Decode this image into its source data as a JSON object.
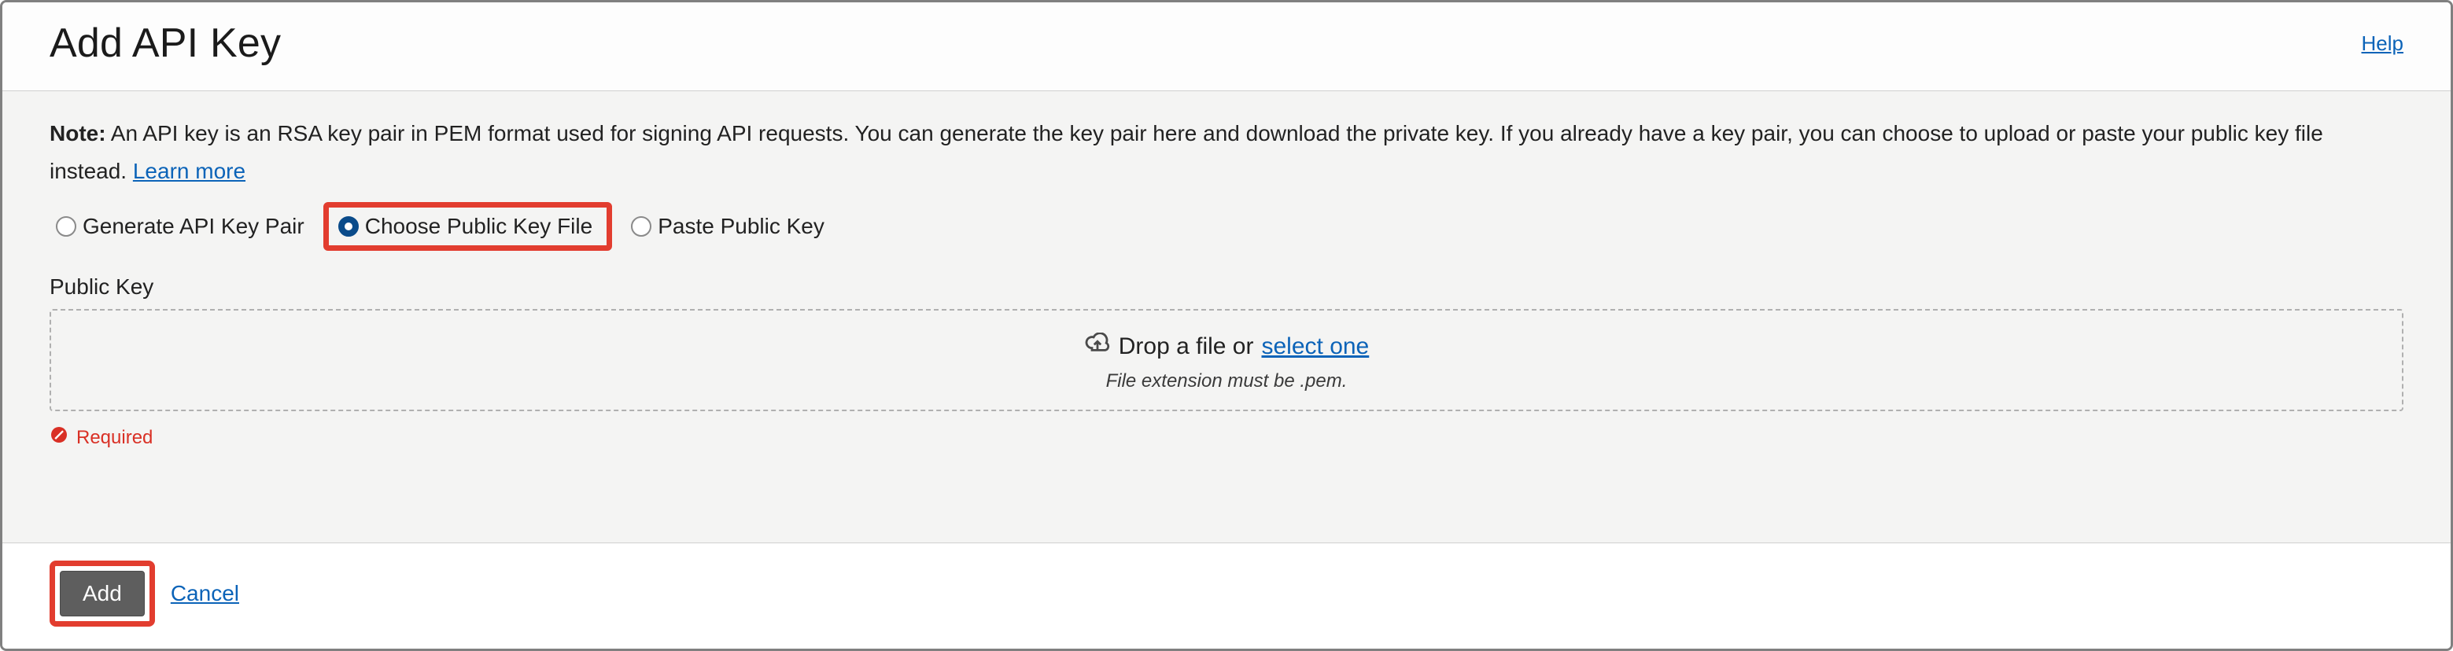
{
  "dialog": {
    "title": "Add API Key",
    "help_label": "Help"
  },
  "note": {
    "prefix": "Note:",
    "text": " An API key is an RSA key pair in PEM format used for signing API requests. You can generate the key pair here and download the private key. If you already have a key pair, you can choose to upload or paste your public key file instead. ",
    "learn_more": "Learn more"
  },
  "radios": {
    "generate": "Generate API Key Pair",
    "choose": "Choose Public Key File",
    "paste": "Paste Public Key",
    "selected": "choose"
  },
  "public_key": {
    "label": "Public Key",
    "drop_prefix": "Drop a file or ",
    "select_one": "select one",
    "extension_hint": "File extension must be .pem."
  },
  "validation": {
    "required": "Required"
  },
  "footer": {
    "add": "Add",
    "cancel": "Cancel"
  }
}
